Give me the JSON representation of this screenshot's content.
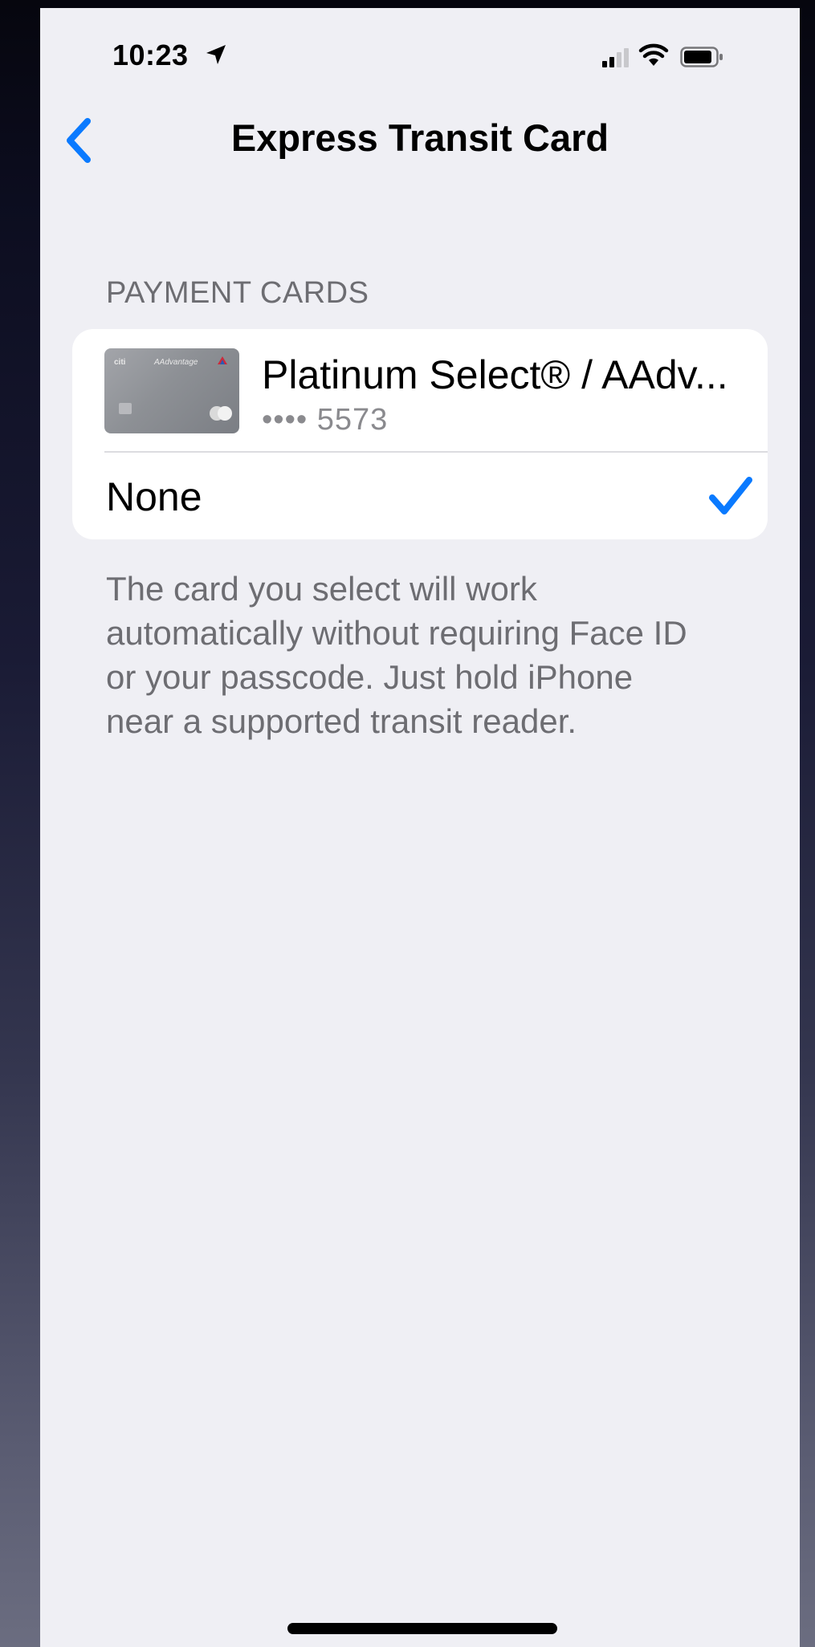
{
  "status_bar": {
    "time": "10:23"
  },
  "nav": {
    "title": "Express Transit Card"
  },
  "payment_cards": {
    "section_header": "PAYMENT CARDS",
    "card": {
      "name": "Platinum Select® / AAdv...",
      "number": "•••• 5573"
    },
    "none_label": "None",
    "selected": "None"
  },
  "footer": {
    "text": "The card you select will work automatically without requiring Face ID or your passcode. Just hold iPhone near a supported transit reader."
  },
  "colors": {
    "accent": "#0a7aff",
    "background": "#efeff4",
    "secondary_text": "#6d6d72"
  }
}
